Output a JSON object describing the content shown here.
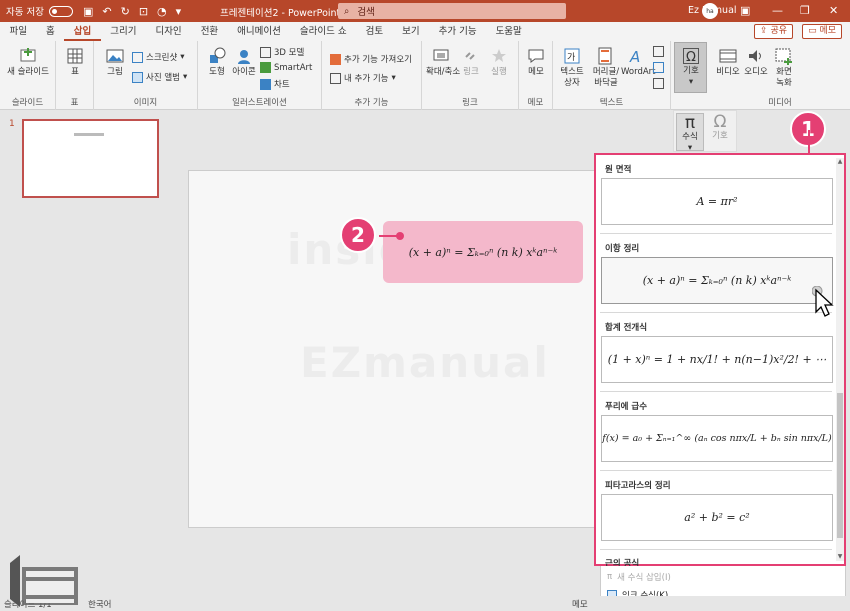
{
  "titlebar": {
    "autosave_label": "자동 저장",
    "autosave_state": "끔",
    "doc_title": "프레젠테이션2  -  PowerPoint",
    "search_placeholder": "검색",
    "user_name": "Ez Manual",
    "avatar_text": "ha"
  },
  "tabs": [
    "파일",
    "홈",
    "삽입",
    "그리기",
    "디자인",
    "전환",
    "애니메이션",
    "슬라이드 쇼",
    "검토",
    "보기",
    "추가 기능",
    "도움말"
  ],
  "active_tab": "삽입",
  "share_label": "공유",
  "memo_label": "메모",
  "ribbon": {
    "new_slide": "새 슬라이드",
    "group_slides": "슬라이드",
    "table": "표",
    "group_table": "표",
    "pictures": "그림",
    "screenshot": "스크린샷",
    "photo_album": "사진 앨범",
    "group_images": "이미지",
    "shapes": "도형",
    "icons": "아이콘",
    "models_3d": "3D 모델",
    "smartart": "SmartArt",
    "chart": "차트",
    "group_illustrations": "일러스트레이션",
    "get_addins": "추가 기능 가져오기",
    "my_addins": "내 추가 기능",
    "group_addins": "추가 기능",
    "zoom": "확대/축소",
    "link": "링크",
    "action": "실행",
    "group_links": "링크",
    "comment": "메모",
    "group_comments": "메모",
    "textbox": "텍스트 상자",
    "header_footer": "머리글/바닥글",
    "wordart": "WordArt",
    "group_text": "텍스트",
    "symbols": "기호",
    "video": "비디오",
    "audio": "오디오",
    "screen_recording": "화면 녹화",
    "group_media": "미디어"
  },
  "eq_dropdown": {
    "equation": "수식",
    "symbol": "기호"
  },
  "slide_number": "1",
  "equation_on_slide": "(x + a)ⁿ = Σₖ₌₀ⁿ (n k) xᵏaⁿ⁻ᵏ",
  "watermark": {
    "line1": "inside BOX",
    "line2": "EZmanual"
  },
  "badges": {
    "one": "1",
    "two": "2"
  },
  "gallery": {
    "items": [
      {
        "title": "원 면적",
        "formula": "A = πr²"
      },
      {
        "title": "이항 정리",
        "formula": "(x + a)ⁿ = Σₖ₌₀ⁿ (n k) xᵏaⁿ⁻ᵏ"
      },
      {
        "title": "합계 전개식",
        "formula": "(1 + x)ⁿ = 1 + nx/1! + n(n−1)x²/2! + ⋯"
      },
      {
        "title": "푸리에 급수",
        "formula": "f(x) = a₀ + Σₙ₌₁^∞ (aₙ cos nπx/L + bₙ sin nπx/L)"
      },
      {
        "title": "피타고라스의 정리",
        "formula": "a² + b² = c²"
      },
      {
        "title": "근의 공식",
        "formula": ""
      }
    ],
    "insert_new": "새 수식 삽입(I)",
    "ink_equation": "잉크 수식(K)"
  },
  "status": {
    "slide": "슬라이드 1/1",
    "language": "한국어",
    "notes": "메모"
  },
  "colors": {
    "accent": "#b7472a",
    "highlight": "#e43f73",
    "eqbox": "#f4b8cb"
  }
}
